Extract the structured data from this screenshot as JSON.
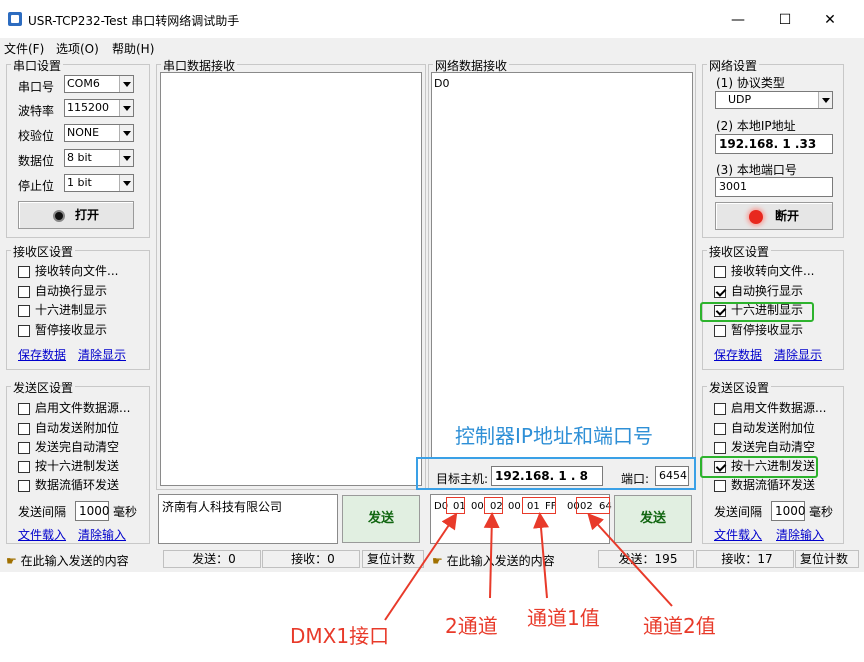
{
  "window": {
    "title": "USR-TCP232-Test 串口转网络调试助手",
    "minimize": "—",
    "maximize": "☐",
    "close": "✕"
  },
  "menu": [
    "文件(F)",
    "选项(O)",
    "帮助(H)"
  ],
  "serial_settings": {
    "title": "串口设置",
    "rows": [
      {
        "label": "串口号",
        "value": "COM6"
      },
      {
        "label": "波特率",
        "value": "115200"
      },
      {
        "label": "校验位",
        "value": "NONE"
      },
      {
        "label": "数据位",
        "value": "8 bit"
      },
      {
        "label": "停止位",
        "value": "1 bit"
      }
    ],
    "open_button": "打开"
  },
  "serial_receive_settings": {
    "title": "接收区设置",
    "options": [
      {
        "label": "接收转向文件...",
        "checked": false
      },
      {
        "label": "自动换行显示",
        "checked": false
      },
      {
        "label": "十六进制显示",
        "checked": false
      },
      {
        "label": "暂停接收显示",
        "checked": false
      }
    ],
    "save_link": "保存数据",
    "clear_link": "清除显示"
  },
  "serial_send_settings": {
    "title": "发送区设置",
    "options": [
      {
        "label": "启用文件数据源...",
        "checked": false
      },
      {
        "label": "自动发送附加位",
        "checked": false
      },
      {
        "label": "发送完自动清空",
        "checked": false
      },
      {
        "label": "按十六进制发送",
        "checked": false
      },
      {
        "label": "数据流循环发送",
        "checked": false
      }
    ],
    "interval_label": "发送间隔",
    "interval_value": "1000",
    "interval_unit": "毫秒",
    "file_link": "文件载入",
    "clear_link": "清除输入"
  },
  "serial_rx": {
    "title": "串口数据接收",
    "content": ""
  },
  "net_rx": {
    "title": "网络数据接收",
    "content": "D0"
  },
  "net_settings": {
    "title": "网络设置",
    "protocol_label": "(1) 协议类型",
    "protocol_value": "UDP",
    "ip_label": "(2) 本地IP地址",
    "ip_value": "192.168. 1 .33",
    "port_label": "(3) 本地端口号",
    "port_value": "3001",
    "disconnect_button": "断开"
  },
  "net_receive_settings": {
    "title": "接收区设置",
    "options": [
      {
        "label": "接收转向文件...",
        "checked": false
      },
      {
        "label": "自动换行显示",
        "checked": true
      },
      {
        "label": "十六进制显示",
        "checked": true
      },
      {
        "label": "暂停接收显示",
        "checked": false
      }
    ],
    "save_link": "保存数据",
    "clear_link": "清除显示"
  },
  "net_send_settings": {
    "title": "发送区设置",
    "options": [
      {
        "label": "启用文件数据源...",
        "checked": false
      },
      {
        "label": "自动发送附加位",
        "checked": false
      },
      {
        "label": "发送完自动清空",
        "checked": false
      },
      {
        "label": "按十六进制发送",
        "checked": true
      },
      {
        "label": "数据流循环发送",
        "checked": false
      }
    ],
    "interval_label": "发送间隔",
    "interval_value": "1000",
    "interval_unit": "毫秒",
    "file_link": "文件载入",
    "clear_link": "清除输入"
  },
  "target": {
    "host_label": "目标主机:",
    "host_value": "192.168. 1 . 8",
    "port_label": "端口:",
    "port_value": "6454"
  },
  "serial_send_text": "济南有人科技有限公司",
  "net_send_bytes": [
    "D0",
    "01",
    "00",
    "02",
    "00",
    "01",
    "FF",
    "00",
    "02",
    "64"
  ],
  "send_button": "发送",
  "status_left": {
    "hint": "在此输入发送的内容",
    "sent": "发送：0",
    "recv": "接收：0",
    "reset": "复位计数"
  },
  "status_right": {
    "hint": "在此输入发送的内容",
    "sent": "发送：195",
    "recv": "接收：17",
    "reset": "复位计数"
  },
  "annotations": {
    "controller_ip": "控制器IP地址和端口号",
    "dmx": "DMX1接口",
    "ch2": "2通道",
    "ch1_val": "通道1值",
    "ch2_val": "通道2值"
  },
  "colors": {
    "annotation_red": "#e83a2a",
    "annotation_blue": "#3aa0e6",
    "highlight_green": "#2db32d",
    "link_blue": "#0000cc"
  }
}
